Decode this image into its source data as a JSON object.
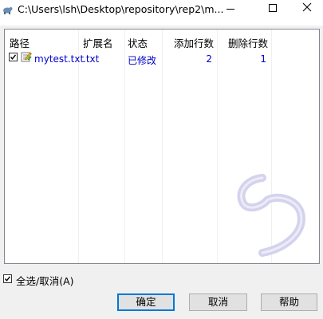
{
  "window": {
    "title": "C:\\Users\\lsh\\Desktop\\repository\\rep2\\m..."
  },
  "list": {
    "columns": [
      "路径",
      "扩展名",
      "状态",
      "添加行数",
      "删除行数"
    ],
    "rows": [
      {
        "checked": true,
        "path": "mytest.txt",
        "extension": ".txt",
        "status": "已修改",
        "lines_added": "2",
        "lines_removed": "1"
      }
    ]
  },
  "select_all": {
    "label": "全选/取消(A)",
    "checked": true
  },
  "buttons": {
    "ok": "确定",
    "cancel": "取消",
    "help": "帮助"
  },
  "colors": {
    "link": "#0000cc",
    "focus_border": "#0078d7",
    "brand_mark": "#d6d4ee"
  }
}
